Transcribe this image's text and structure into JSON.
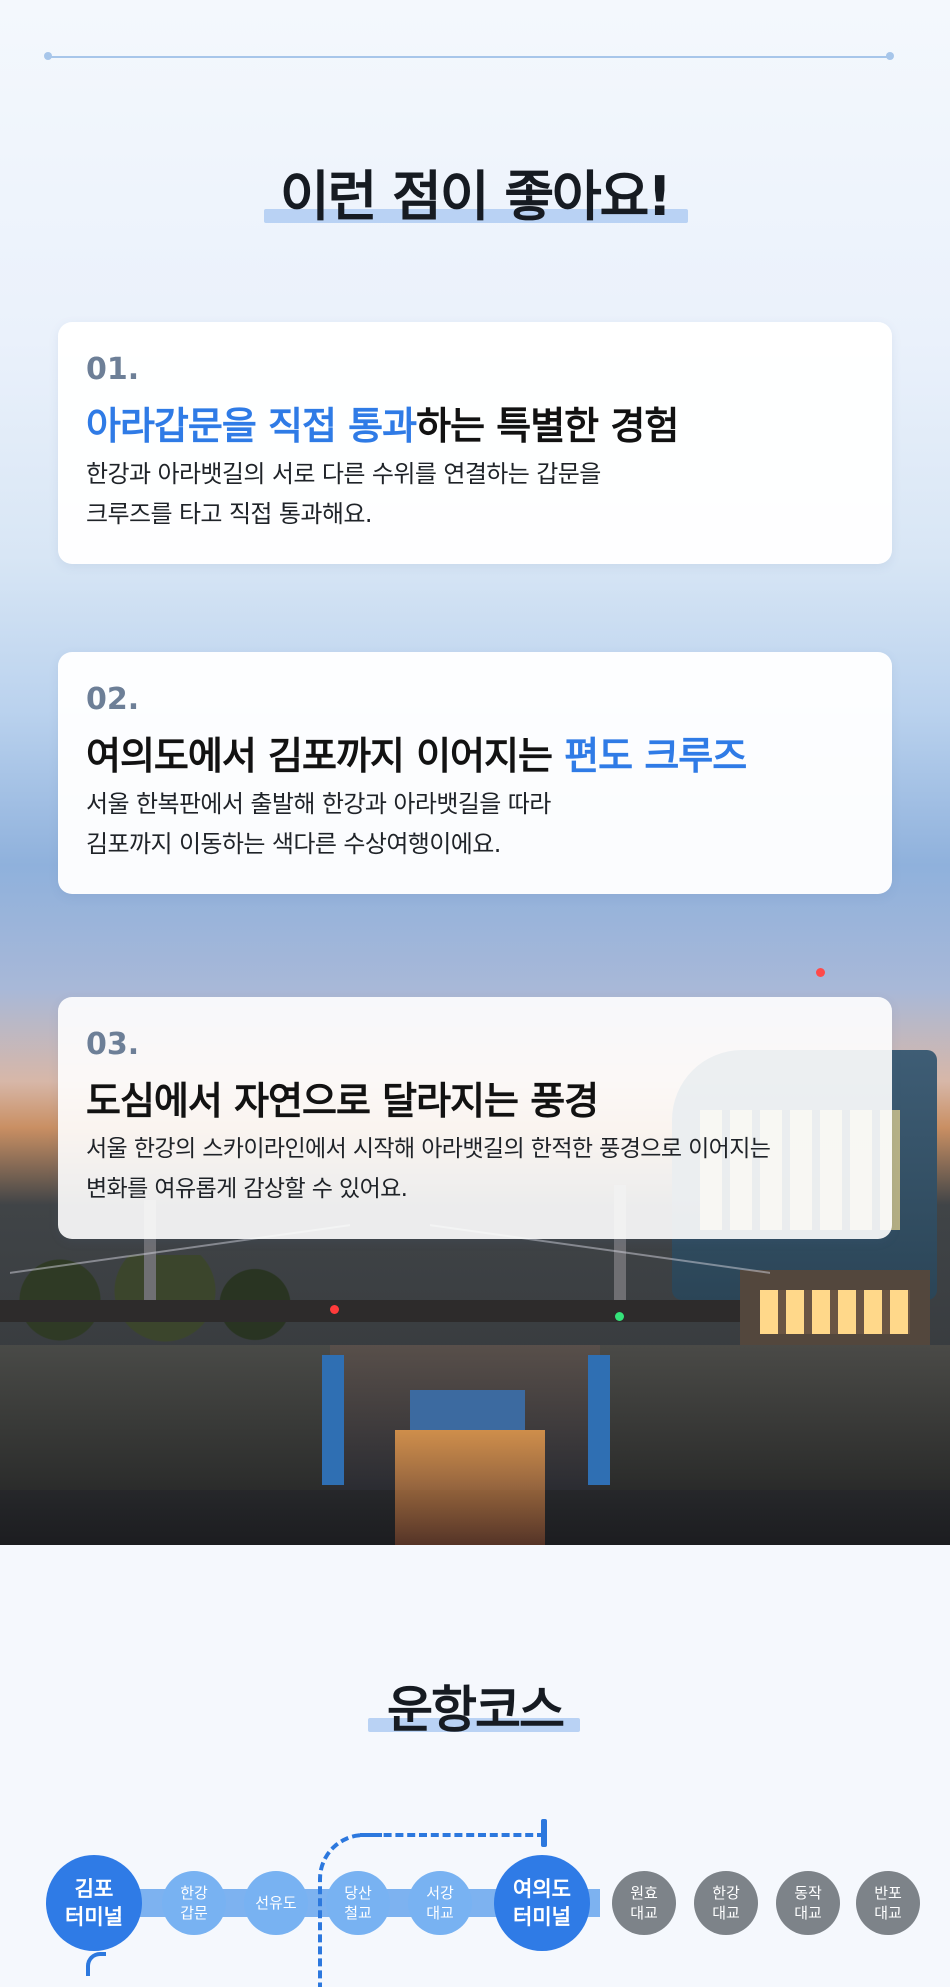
{
  "benefits": {
    "title": "이런 점이 좋아요!",
    "cards": [
      {
        "num": "01.",
        "head_blue": "아라갑문을 직접 통과",
        "head_black": "하는 특별한 경험",
        "desc1": "한강과 아라뱃길의 서로 다른 수위를 연결하는 갑문을",
        "desc2": "크루즈를 타고 직접 통과해요."
      },
      {
        "num": "02.",
        "head_black": "여의도에서 김포까지 이어지는 ",
        "head_blue": "편도 크루즈",
        "desc1": "서울 한복판에서 출발해 한강과 아라뱃길을 따라",
        "desc2": "김포까지 이동하는 색다른 수상여행이에요."
      },
      {
        "num": "03.",
        "head_black": "도심에서 자연으로 달라지는 풍경",
        "desc1": "서울 한강의 스카이라인에서 시작해 아라뱃길의 한적한 풍경으로 이어지는",
        "desc2": "변화를 여유롭게 감상할 수 있어요."
      }
    ]
  },
  "course": {
    "title": "운항코스",
    "stops": [
      {
        "line1": "김포",
        "line2": "터미널"
      },
      {
        "line1": "한강",
        "line2": "갑문"
      },
      {
        "line1": "선유도",
        "line2": ""
      },
      {
        "line1": "당산",
        "line2": "철교"
      },
      {
        "line1": "서강",
        "line2": "대교"
      },
      {
        "line1": "여의도",
        "line2": "터미널"
      },
      {
        "line1": "원효",
        "line2": "대교"
      },
      {
        "line1": "한강",
        "line2": "대교"
      },
      {
        "line1": "동작",
        "line2": "대교"
      },
      {
        "line1": "반포",
        "line2": "대교"
      }
    ]
  },
  "colors": {
    "accent_blue": "#2f7be6",
    "light_blue": "#78b2f2",
    "gray_stop": "#7d8389",
    "highlight": "#b9d2f4"
  }
}
